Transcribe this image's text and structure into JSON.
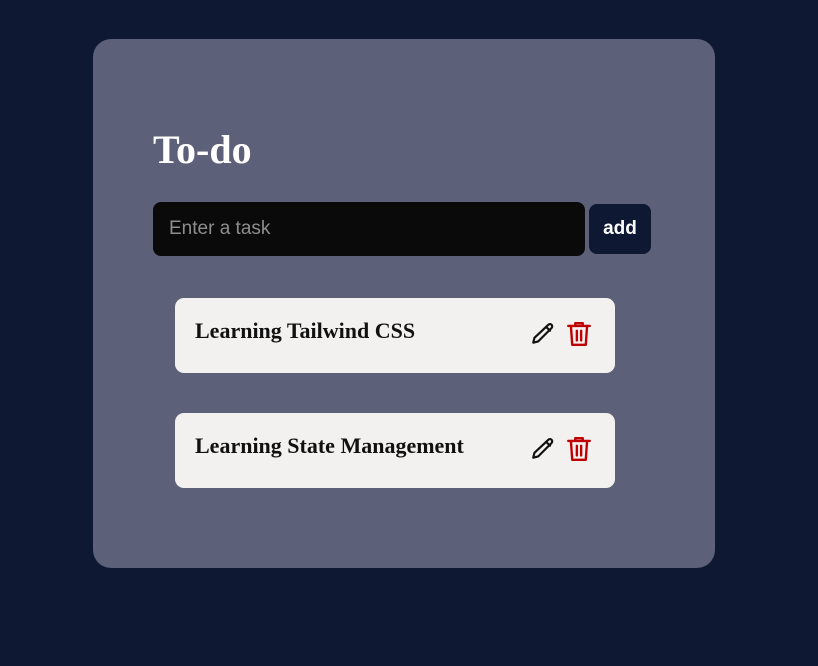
{
  "app": {
    "title": "To-do"
  },
  "form": {
    "placeholder": "Enter a task",
    "value": "",
    "add_label": "add"
  },
  "todos": [
    {
      "text": "Learning Tailwind CSS",
      "edit_icon": "pencil-icon",
      "delete_icon": "trash-icon"
    },
    {
      "text": "Learning State Management",
      "edit_icon": "pencil-icon",
      "delete_icon": "trash-icon"
    }
  ],
  "colors": {
    "page_background": "#0e1832",
    "card_background": "#5c6079",
    "input_background": "#0a0a0a",
    "add_button_background": "#0e1832",
    "item_background": "#f3f1f0",
    "delete_icon": "#c00000",
    "edit_icon": "#111111"
  }
}
